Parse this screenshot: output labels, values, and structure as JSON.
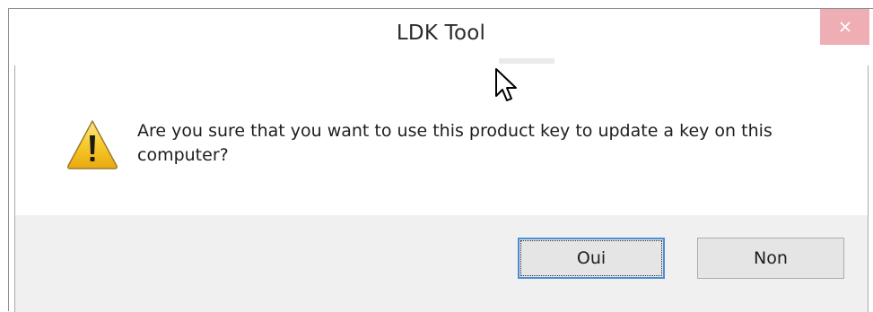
{
  "window": {
    "title": "LDK Tool",
    "close_icon": "close-icon"
  },
  "dialog": {
    "icon": "warning-icon",
    "message": "Are you sure that you want to use this product key to update a key on this computer?"
  },
  "buttons": {
    "yes_label": "Oui",
    "no_label": "Non"
  },
  "colors": {
    "close_button_bg": "#eeaeb4",
    "button_panel_bg": "#f0f0f0",
    "focus_border": "#4d8fd6",
    "warning_yellow": "#f5c518"
  },
  "cursor": "mouse-pointer-icon"
}
